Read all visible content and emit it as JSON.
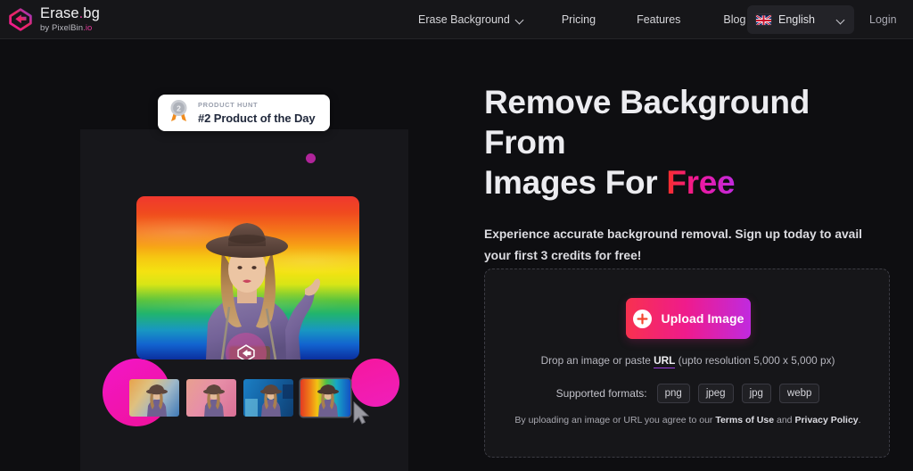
{
  "header": {
    "brand": {
      "name_main": "Erase",
      "name_dot": ".",
      "name_ext": "bg",
      "sub_prefix": "by PixelBin",
      "sub_ext": ".io",
      "logo_icon": "erasebg-diamond-logo-icon"
    },
    "nav": [
      {
        "label": "Erase Background",
        "has_chevron": true
      },
      {
        "label": "Pricing",
        "has_chevron": false
      },
      {
        "label": "Features",
        "has_chevron": false
      },
      {
        "label": "Blog",
        "has_chevron": false
      }
    ],
    "language": {
      "label": "English",
      "flag": "uk-union-jack-flag-icon",
      "chevron": "chevron-down-icon"
    },
    "login_label": "Login"
  },
  "hero": {
    "product_hunt_badge": {
      "kicker": "PRODUCT HUNT",
      "title": "#2 Product of the Day",
      "medal_icon": "silver-medal-2-icon"
    },
    "preview_logo_icon": "erasebg-watermark-icon",
    "thumbnails": [
      {
        "name": "thumbnail-gradient-sunset",
        "active": false
      },
      {
        "name": "thumbnail-pink-studio",
        "active": false
      },
      {
        "name": "thumbnail-blue-geometric",
        "active": false
      },
      {
        "name": "thumbnail-rainbow-paint",
        "active": true
      }
    ],
    "cursor_icon": "mouse-pointer-icon"
  },
  "main": {
    "headline_line1": "Remove Background From",
    "headline_line2_prefix": "Images For ",
    "headline_highlight": "Free",
    "subheadline": "Experience accurate background removal. Sign up today to avail your first 3 credits for free!"
  },
  "upload": {
    "button_label": "Upload Image",
    "plus_icon": "plus-icon",
    "drop_prefix": "Drop an image or paste ",
    "drop_url_label": "URL",
    "drop_suffix": " (upto resolution 5,000 x 5,000 px)",
    "formats_label": "Supported formats:",
    "formats": [
      "png",
      "jpeg",
      "jpg",
      "webp"
    ],
    "legal_prefix": "By uploading an image or URL you agree to our ",
    "legal_terms": "Terms of Use",
    "legal_and": " and ",
    "legal_privacy": "Privacy Policy",
    "legal_suffix": "."
  },
  "colors": {
    "page_bg": "#0e0e11",
    "header_bg": "#161619",
    "panel_bg": "#17171b",
    "accent_pink": "#ef1b8c",
    "accent_red": "#f8314f",
    "accent_purple": "#c02adf",
    "blob_magenta": "#f0129a"
  }
}
